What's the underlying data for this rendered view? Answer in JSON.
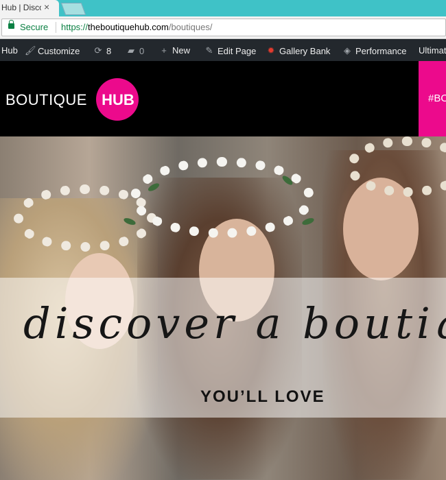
{
  "tab": {
    "title": "Hub | Disco",
    "close": "×"
  },
  "address": {
    "secure_label": "Secure",
    "url_protocol": "https://",
    "url_domain": "theboutiquehub.com",
    "url_path": "/boutiques/"
  },
  "adminbar": {
    "items": [
      {
        "label": "Hub"
      },
      {
        "label": "Customize"
      },
      {
        "label": "8"
      },
      {
        "label": "0"
      },
      {
        "label": "New"
      },
      {
        "label": "Edit Page"
      },
      {
        "label": "Gallery Bank"
      },
      {
        "label": "Performance"
      },
      {
        "label": "Ultimat"
      }
    ]
  },
  "header": {
    "logo_word": "BOUTIQUE",
    "logo_hub": "HUB",
    "hashtag": "#BO"
  },
  "hero": {
    "script_text": "discover a boutique",
    "tagline": "YOU’LL LOVE"
  },
  "colors": {
    "brand_pink": "#ec0a8c",
    "tab_strip": "#3fc2c7",
    "adminbar": "#23282d"
  }
}
